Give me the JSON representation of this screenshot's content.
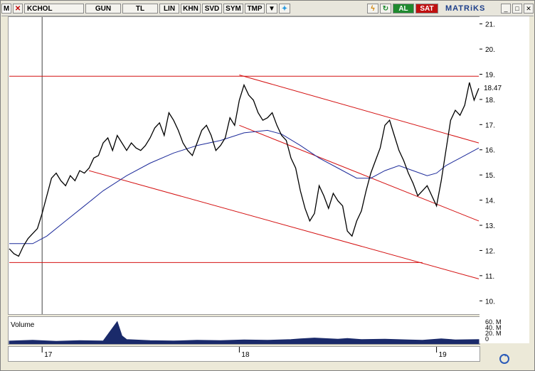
{
  "toolbar": {
    "m_label": "M",
    "symbol": "KCHOL",
    "period": "GUN",
    "currency": "TL",
    "scale": "LIN",
    "btn_khn": "KHN",
    "btn_svd": "SVD",
    "btn_sym": "SYM",
    "btn_tmp": "TMP",
    "buy_label": "AL",
    "sell_label": "SAT",
    "brand": "MATRiKS"
  },
  "volume_panel": {
    "label": "Volume",
    "ticks": [
      "60. M",
      "40. M",
      "20. M",
      "0"
    ]
  },
  "colors": {
    "price": "#000000",
    "moving_average": "#1c2a9a",
    "trendlines": "#d41010",
    "volume": "#1a2a6a",
    "buy": "#1f8a2f",
    "sell": "#c01010"
  },
  "chart_data": {
    "type": "line",
    "title": "",
    "xlabel": "",
    "ylabel": "",
    "ylim": [
      9.5,
      21.3
    ],
    "y_ticks": [
      10.0,
      11.0,
      12.0,
      13.0,
      14.0,
      15.0,
      16.0,
      17.0,
      18.0,
      19.0,
      20.0,
      21.0
    ],
    "y_tick_labels": [
      "10.",
      "11.",
      "12.",
      "13.",
      "14.",
      "15.",
      "16.",
      "17.",
      "18.",
      "19.",
      "20.",
      "21."
    ],
    "last_value_label": "18.47",
    "x_labels": [
      {
        "label": "17",
        "t": 0.07
      },
      {
        "label": "18",
        "t": 0.49
      },
      {
        "label": "19",
        "t": 0.91
      }
    ],
    "price_series": [
      [
        0.0,
        12.1
      ],
      [
        0.01,
        11.9
      ],
      [
        0.02,
        11.8
      ],
      [
        0.03,
        12.2
      ],
      [
        0.04,
        12.5
      ],
      [
        0.05,
        12.7
      ],
      [
        0.06,
        12.9
      ],
      [
        0.07,
        13.5
      ],
      [
        0.08,
        14.2
      ],
      [
        0.09,
        14.9
      ],
      [
        0.1,
        15.1
      ],
      [
        0.11,
        14.8
      ],
      [
        0.12,
        14.6
      ],
      [
        0.13,
        15.0
      ],
      [
        0.14,
        14.8
      ],
      [
        0.15,
        15.2
      ],
      [
        0.16,
        15.1
      ],
      [
        0.17,
        15.3
      ],
      [
        0.18,
        15.7
      ],
      [
        0.19,
        15.8
      ],
      [
        0.2,
        16.3
      ],
      [
        0.21,
        16.5
      ],
      [
        0.22,
        16.0
      ],
      [
        0.23,
        16.6
      ],
      [
        0.24,
        16.3
      ],
      [
        0.25,
        16.0
      ],
      [
        0.26,
        16.3
      ],
      [
        0.27,
        16.1
      ],
      [
        0.28,
        16.0
      ],
      [
        0.29,
        16.2
      ],
      [
        0.3,
        16.5
      ],
      [
        0.31,
        16.9
      ],
      [
        0.32,
        17.1
      ],
      [
        0.33,
        16.6
      ],
      [
        0.34,
        17.5
      ],
      [
        0.35,
        17.2
      ],
      [
        0.36,
        16.8
      ],
      [
        0.37,
        16.3
      ],
      [
        0.38,
        16.0
      ],
      [
        0.39,
        15.8
      ],
      [
        0.4,
        16.3
      ],
      [
        0.41,
        16.8
      ],
      [
        0.42,
        17.0
      ],
      [
        0.43,
        16.6
      ],
      [
        0.44,
        16.0
      ],
      [
        0.45,
        16.2
      ],
      [
        0.46,
        16.5
      ],
      [
        0.47,
        17.3
      ],
      [
        0.48,
        17.0
      ],
      [
        0.49,
        18.0
      ],
      [
        0.5,
        18.6
      ],
      [
        0.51,
        18.2
      ],
      [
        0.52,
        18.0
      ],
      [
        0.53,
        17.5
      ],
      [
        0.54,
        17.2
      ],
      [
        0.55,
        17.3
      ],
      [
        0.56,
        17.5
      ],
      [
        0.57,
        17.0
      ],
      [
        0.58,
        16.6
      ],
      [
        0.59,
        16.4
      ],
      [
        0.6,
        15.7
      ],
      [
        0.61,
        15.3
      ],
      [
        0.62,
        14.4
      ],
      [
        0.63,
        13.7
      ],
      [
        0.64,
        13.2
      ],
      [
        0.65,
        13.5
      ],
      [
        0.66,
        14.6
      ],
      [
        0.67,
        14.2
      ],
      [
        0.68,
        13.7
      ],
      [
        0.69,
        14.3
      ],
      [
        0.7,
        14.0
      ],
      [
        0.71,
        13.8
      ],
      [
        0.72,
        12.8
      ],
      [
        0.73,
        12.6
      ],
      [
        0.74,
        13.2
      ],
      [
        0.75,
        13.6
      ],
      [
        0.76,
        14.4
      ],
      [
        0.77,
        15.1
      ],
      [
        0.78,
        15.6
      ],
      [
        0.79,
        16.1
      ],
      [
        0.8,
        17.0
      ],
      [
        0.81,
        17.2
      ],
      [
        0.82,
        16.6
      ],
      [
        0.83,
        16.0
      ],
      [
        0.84,
        15.6
      ],
      [
        0.85,
        15.1
      ],
      [
        0.86,
        14.7
      ],
      [
        0.87,
        14.2
      ],
      [
        0.88,
        14.4
      ],
      [
        0.89,
        14.6
      ],
      [
        0.9,
        14.2
      ],
      [
        0.91,
        13.8
      ],
      [
        0.92,
        14.8
      ],
      [
        0.93,
        16.0
      ],
      [
        0.94,
        17.2
      ],
      [
        0.95,
        17.6
      ],
      [
        0.96,
        17.4
      ],
      [
        0.97,
        17.8
      ],
      [
        0.98,
        18.7
      ],
      [
        0.99,
        18.0
      ],
      [
        1.0,
        18.47
      ]
    ],
    "ma_series": [
      [
        0.0,
        12.3
      ],
      [
        0.05,
        12.3
      ],
      [
        0.08,
        12.6
      ],
      [
        0.12,
        13.2
      ],
      [
        0.16,
        13.8
      ],
      [
        0.2,
        14.4
      ],
      [
        0.25,
        15.0
      ],
      [
        0.3,
        15.5
      ],
      [
        0.35,
        15.9
      ],
      [
        0.4,
        16.2
      ],
      [
        0.45,
        16.4
      ],
      [
        0.5,
        16.7
      ],
      [
        0.55,
        16.8
      ],
      [
        0.58,
        16.65
      ],
      [
        0.62,
        16.2
      ],
      [
        0.66,
        15.7
      ],
      [
        0.7,
        15.3
      ],
      [
        0.74,
        14.9
      ],
      [
        0.77,
        14.9
      ],
      [
        0.8,
        15.2
      ],
      [
        0.83,
        15.4
      ],
      [
        0.86,
        15.2
      ],
      [
        0.89,
        15.0
      ],
      [
        0.91,
        15.1
      ],
      [
        0.93,
        15.4
      ],
      [
        0.96,
        15.7
      ],
      [
        1.0,
        16.1
      ]
    ],
    "trendlines": [
      {
        "from": [
          0.0,
          18.95
        ],
        "to": [
          1.0,
          18.95
        ]
      },
      {
        "from": [
          0.0,
          11.55
        ],
        "to": [
          0.88,
          11.55
        ]
      },
      {
        "from": [
          0.49,
          19.0
        ],
        "to": [
          1.0,
          16.3
        ]
      },
      {
        "from": [
          0.49,
          17.0
        ],
        "to": [
          1.0,
          13.2
        ]
      },
      {
        "from": [
          0.17,
          15.2
        ],
        "to": [
          1.0,
          10.9
        ]
      }
    ],
    "volume_series": [
      [
        0.0,
        8
      ],
      [
        0.05,
        10
      ],
      [
        0.1,
        7
      ],
      [
        0.15,
        9
      ],
      [
        0.2,
        8
      ],
      [
        0.23,
        60
      ],
      [
        0.24,
        22
      ],
      [
        0.25,
        12
      ],
      [
        0.3,
        9
      ],
      [
        0.35,
        8
      ],
      [
        0.4,
        10
      ],
      [
        0.45,
        9
      ],
      [
        0.5,
        11
      ],
      [
        0.55,
        10
      ],
      [
        0.6,
        12
      ],
      [
        0.62,
        14
      ],
      [
        0.65,
        16
      ],
      [
        0.7,
        13
      ],
      [
        0.72,
        15
      ],
      [
        0.75,
        12
      ],
      [
        0.8,
        13
      ],
      [
        0.85,
        11
      ],
      [
        0.88,
        10
      ],
      [
        0.9,
        12
      ],
      [
        0.92,
        14
      ],
      [
        0.95,
        11
      ],
      [
        1.0,
        12
      ]
    ],
    "volume_ylim": [
      0,
      65
    ]
  }
}
